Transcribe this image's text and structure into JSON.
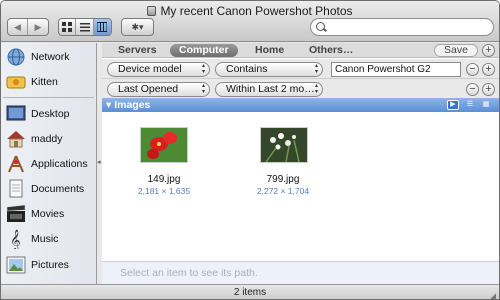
{
  "window": {
    "title": "My recent Canon Powershot Photos"
  },
  "toolbar": {
    "back_glyph": "◀",
    "forward_glyph": "▶",
    "action_glyph": "✱▾"
  },
  "sidebar": {
    "items": [
      {
        "label": "Network",
        "icon": "network-icon"
      },
      {
        "label": "Kitten",
        "icon": "disk-icon"
      },
      {
        "label": "Desktop",
        "icon": "desktop-icon"
      },
      {
        "label": "maddy",
        "icon": "home-icon"
      },
      {
        "label": "Applications",
        "icon": "applications-icon"
      },
      {
        "label": "Documents",
        "icon": "documents-icon"
      },
      {
        "label": "Movies",
        "icon": "movies-icon"
      },
      {
        "label": "Music",
        "icon": "music-icon"
      },
      {
        "label": "Pictures",
        "icon": "pictures-icon"
      }
    ]
  },
  "scope": {
    "servers": "Servers",
    "computer": "Computer",
    "home": "Home",
    "others": "Others…",
    "save": "Save"
  },
  "criteria": [
    {
      "attribute": "Device model",
      "operator": "Contains",
      "value": "Canon Powershot G2"
    },
    {
      "attribute": "Last Opened",
      "operator": "Within Last 2 mo…"
    }
  ],
  "group": {
    "title": "Images"
  },
  "files": [
    {
      "name": "149.jpg",
      "dimensions": "2,181 × 1,635"
    },
    {
      "name": "799.jpg",
      "dimensions": "2,272 × 1,704"
    }
  ],
  "path_hint": "Select an item to see its path.",
  "status": "2 items",
  "colors": {
    "selection_blue": "#5b8ed5",
    "dimension_text": "#5a7bb5"
  }
}
